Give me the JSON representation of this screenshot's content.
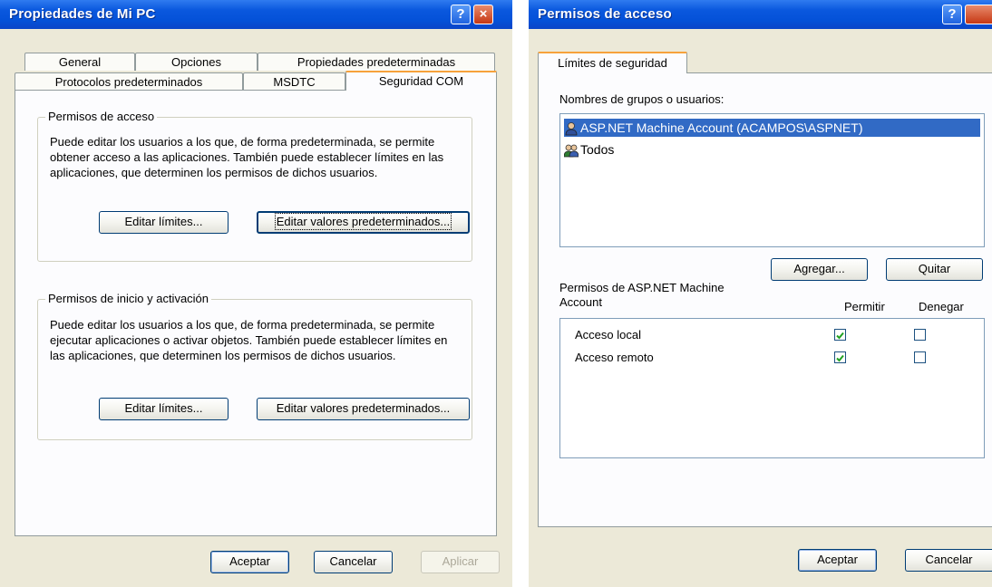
{
  "left_window": {
    "title": "Propiedades de Mi PC",
    "help_glyph": "?",
    "close_glyph": "×",
    "tabs_row1": [
      "General",
      "Opciones",
      "Propiedades predeterminadas"
    ],
    "tabs_row2": [
      "Protocolos predeterminados",
      "MSDTC",
      "Seguridad COM"
    ],
    "active_tab": "Seguridad COM",
    "access_group": {
      "label": "Permisos de acceso",
      "description": "Puede editar los usuarios a los que, de forma predeterminada, se permite obtener acceso a las aplicaciones. También puede establecer límites en las aplicaciones, que determinen los permisos de dichos usuarios.",
      "edit_limits": "Editar límites...",
      "edit_defaults": "Editar valores predeterminados..."
    },
    "launch_group": {
      "label": "Permisos de inicio y activación",
      "description": "Puede editar los usuarios a los que, de forma predeterminada, se permite ejecutar aplicaciones o activar objetos. También puede establecer límites en las aplicaciones, que determinen los permisos de dichos usuarios.",
      "edit_limits": "Editar límites...",
      "edit_defaults": "Editar valores predeterminados..."
    },
    "ok": "Aceptar",
    "cancel": "Cancelar",
    "apply": "Aplicar"
  },
  "right_window": {
    "title": "Permisos de acceso",
    "help_glyph": "?",
    "tab": "Límites de seguridad",
    "users_label": "Nombres de grupos o usuarios:",
    "users": [
      {
        "name": "ASP.NET Machine Account (ACAMPOS\\ASPNET)",
        "icon": "user-icon",
        "selected": true
      },
      {
        "name": "Todos",
        "icon": "group-icon",
        "selected": false
      }
    ],
    "add": "Agregar...",
    "remove": "Quitar",
    "perm_label_line1": "Permisos de ASP.NET Machine",
    "perm_label_line2": "Account",
    "allow_header": "Permitir",
    "deny_header": "Denegar",
    "permissions": [
      {
        "name": "Acceso local",
        "allow": true,
        "deny": false
      },
      {
        "name": "Acceso remoto",
        "allow": true,
        "deny": false
      }
    ],
    "ok": "Aceptar",
    "cancel": "Cancelar"
  }
}
